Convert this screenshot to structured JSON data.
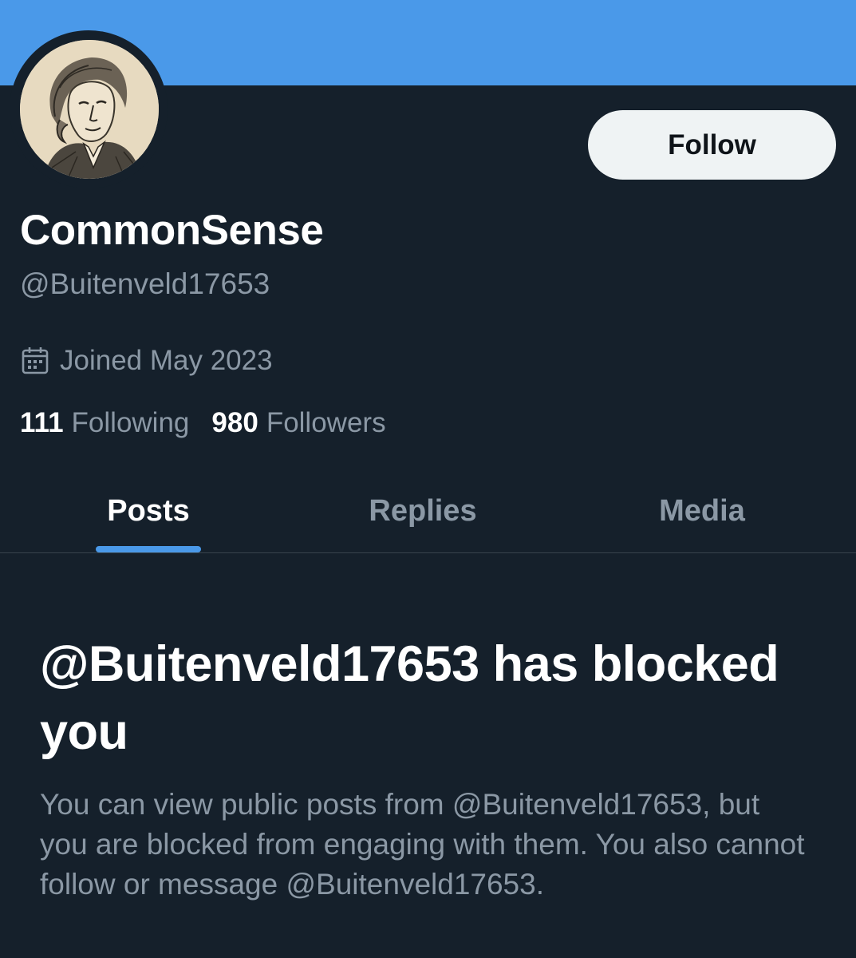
{
  "profile": {
    "display_name": "CommonSense",
    "handle": "@Buitenveld17653",
    "joined": "Joined May 2023",
    "follow_label": "Follow",
    "stats": {
      "following_count": "111",
      "following_label": "Following",
      "followers_count": "980",
      "followers_label": "Followers"
    }
  },
  "tabs": [
    {
      "label": "Posts",
      "active": true
    },
    {
      "label": "Replies",
      "active": false
    },
    {
      "label": "Media",
      "active": false
    }
  ],
  "blocked": {
    "title": "@Buitenveld17653 has blocked you",
    "message": "You can view public posts from @Buitenveld17653, but you are blocked from engaging with them. You also cannot follow or message @Buitenveld17653."
  },
  "colors": {
    "background": "#15202b",
    "banner": "#4a99e9",
    "accent": "#4a99e9",
    "text_primary": "#ffffff",
    "text_secondary": "#8b98a5",
    "button_bg": "#eff3f4"
  },
  "icons": {
    "joined": "calendar-icon",
    "avatar": "portrait-engraving"
  }
}
